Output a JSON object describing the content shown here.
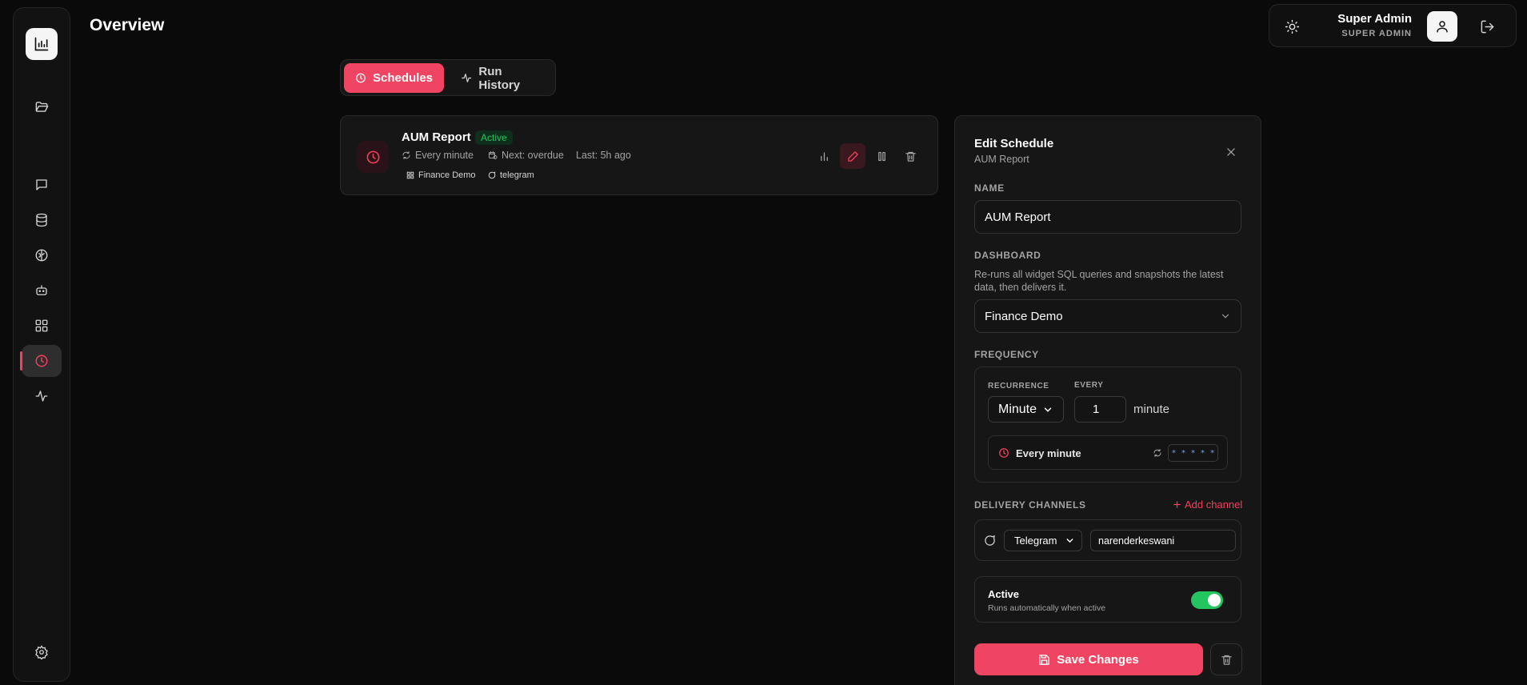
{
  "page": {
    "title": "Overview"
  },
  "sidebar": {
    "logo_icon": "bar-chart-icon",
    "items": [
      {
        "name": "folder",
        "icon": "folder-open-icon"
      },
      {
        "name": "chat",
        "icon": "message-icon"
      },
      {
        "name": "database",
        "icon": "database-icon"
      },
      {
        "name": "brain",
        "icon": "brain-icon"
      },
      {
        "name": "bot",
        "icon": "bot-icon"
      },
      {
        "name": "dashboards",
        "icon": "grid-icon"
      },
      {
        "name": "schedules",
        "icon": "clock-icon",
        "active": true
      },
      {
        "name": "activity",
        "icon": "activity-icon"
      },
      {
        "name": "settings",
        "icon": "gear-icon"
      }
    ]
  },
  "header": {
    "user_name": "Super Admin",
    "user_role": "SUPER ADMIN"
  },
  "tabs": {
    "schedules_label": "Schedules",
    "history_label": "Run History"
  },
  "schedule": {
    "title": "AUM Report",
    "status": "Active",
    "frequency": "Every minute",
    "next": "Next: overdue",
    "last": "Last: 5h ago",
    "dashboard_tag": "Finance Demo",
    "channel_tag": "telegram"
  },
  "edit_panel": {
    "title": "Edit Schedule",
    "subtitle": "AUM Report",
    "name_label": "NAME",
    "name_value": "AUM Report",
    "dashboard_label": "DASHBOARD",
    "dashboard_help": "Re-runs all widget SQL queries and snapshots the latest data, then delivers it.",
    "dashboard_value": "Finance Demo",
    "frequency_label": "FREQUENCY",
    "recurrence_label": "RECURRENCE",
    "every_label": "EVERY",
    "recurrence_value": "Minute",
    "every_value": "1",
    "every_unit": "minute",
    "preview_text": "Every minute",
    "cron": "* * * * *",
    "delivery_label": "DELIVERY CHANNELS",
    "add_channel": "Add channel",
    "channel_type": "Telegram",
    "channel_target": "narenderkeswani",
    "active_label": "Active",
    "active_help": "Runs automatically when active",
    "active_on": true,
    "save_label": "Save Changes"
  },
  "colors": {
    "accent": "#ef4562",
    "success": "#22c55e",
    "background": "#0a0a0a",
    "panel": "#161616"
  }
}
